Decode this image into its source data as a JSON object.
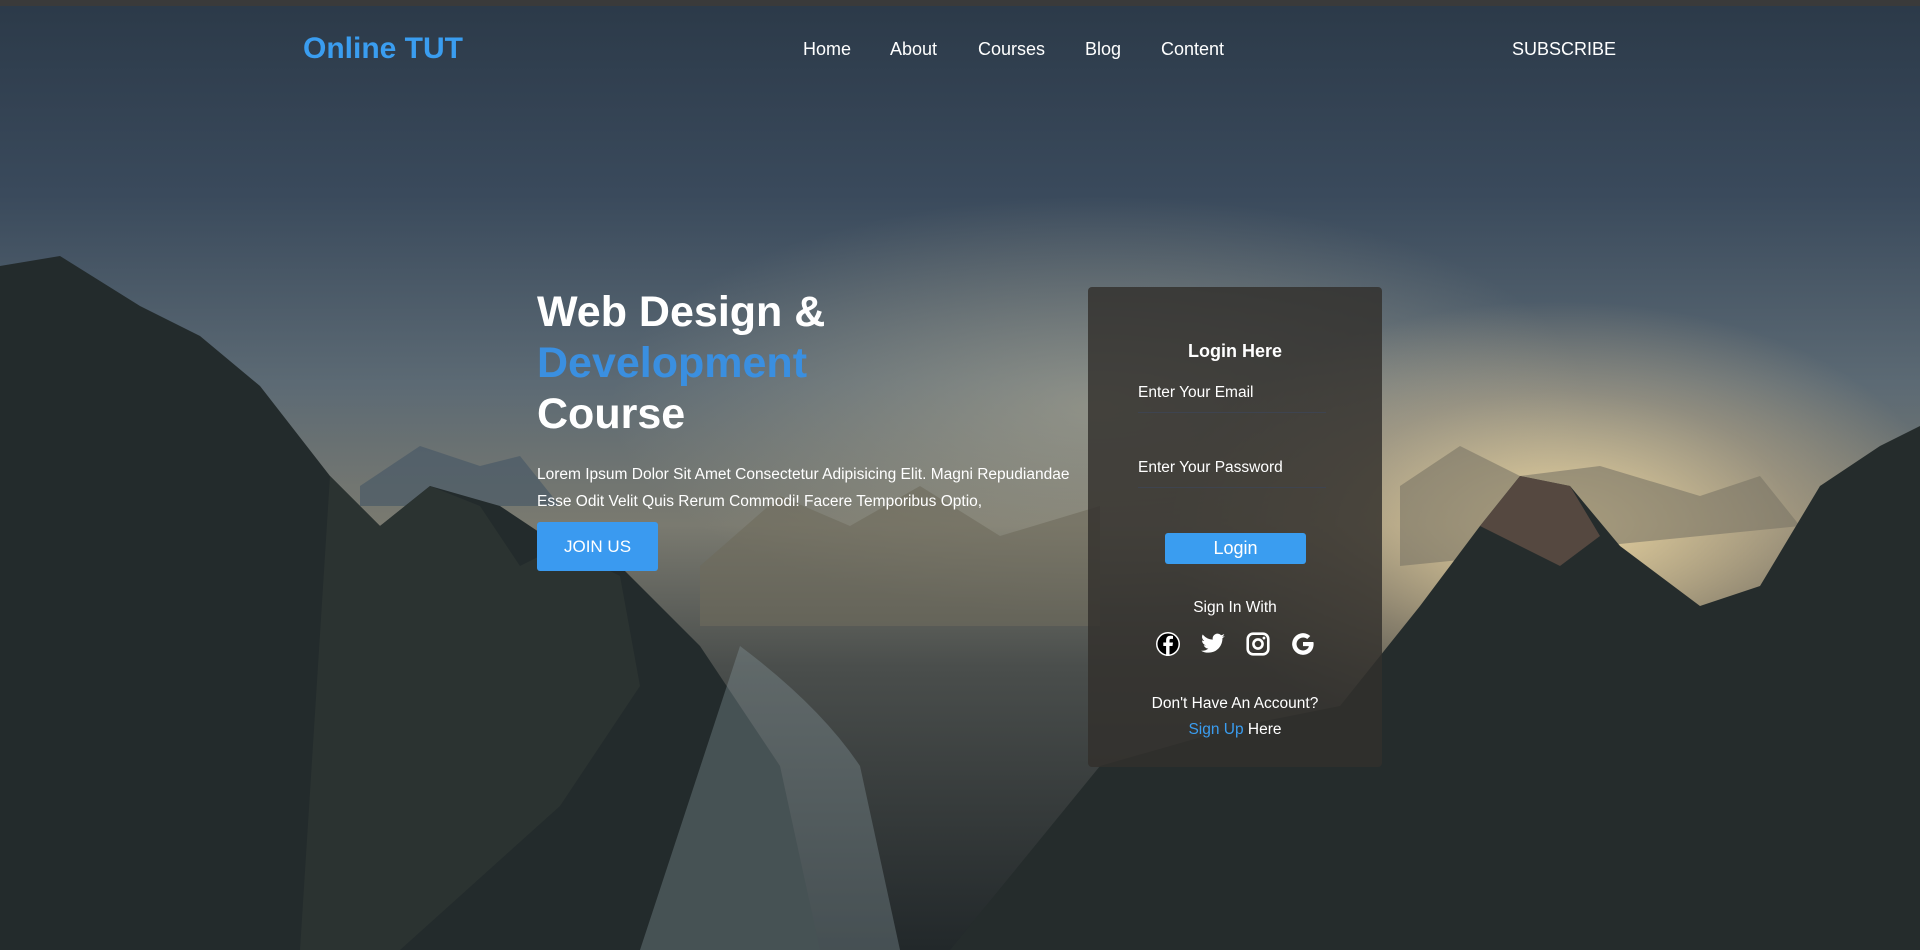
{
  "header": {
    "logo": "Online TUT",
    "nav": [
      "Home",
      "About",
      "Courses",
      "Blog",
      "Content"
    ],
    "subscribe": "SUBSCRIBE"
  },
  "hero": {
    "title_line1": "Web Design &",
    "title_line2": "Development",
    "title_line3": "Course",
    "paragraph_line1": "Lorem Ipsum Dolor Sit Amet Consectetur Adipisicing Elit. Magni Repudiandae",
    "paragraph_line2": "Esse Odit Velit Quis Rerum Commodi! Facere Temporibus Optio,",
    "join_label": "JOIN US"
  },
  "login": {
    "title": "Login Here",
    "email_placeholder": "Enter Your Email",
    "password_placeholder": "Enter Your Password",
    "button": "Login",
    "sign_in_with": "Sign In With",
    "social": [
      "facebook-icon",
      "twitter-icon",
      "instagram-icon",
      "google-icon"
    ],
    "no_account": "Don't Have An Account?",
    "sign_up": "Sign Up",
    "here": "Here"
  },
  "colors": {
    "accent": "#3a9df0"
  }
}
